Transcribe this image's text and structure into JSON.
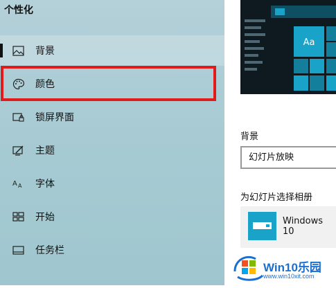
{
  "sidebar": {
    "title": "个性化",
    "items": [
      {
        "label": "背景",
        "icon": "picture-icon"
      },
      {
        "label": "颜色",
        "icon": "palette-icon"
      },
      {
        "label": "锁屏界面",
        "icon": "lock-screen-icon"
      },
      {
        "label": "主题",
        "icon": "theme-icon"
      },
      {
        "label": "字体",
        "icon": "font-icon"
      },
      {
        "label": "开始",
        "icon": "start-icon"
      },
      {
        "label": "任务栏",
        "icon": "taskbar-icon"
      }
    ],
    "selected_index": 0,
    "highlighted_index": 1
  },
  "preview": {
    "tile_text": "Aa"
  },
  "background_section": {
    "heading": "背景",
    "dropdown_value": "幻灯片放映"
  },
  "album_section": {
    "heading": "为幻灯片选择相册",
    "album_name": "Windows 10"
  },
  "watermark": {
    "brand": "Win10乐园",
    "url": "www.win10xit.com"
  },
  "colors": {
    "sidebar_bg": "#a9ccd4",
    "highlight": "#e11a1a",
    "accent_tile": "#1aa3c9",
    "preview_bg": "#0e1a20"
  }
}
